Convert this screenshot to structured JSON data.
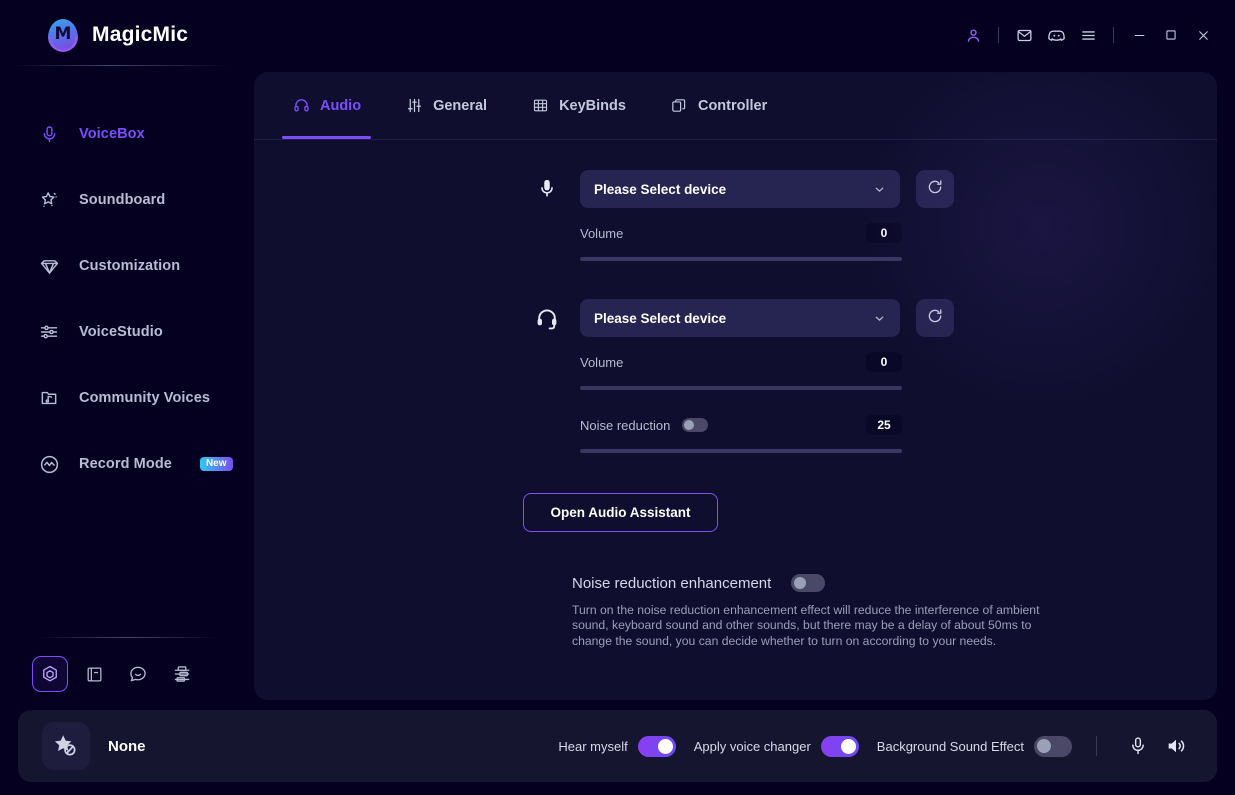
{
  "app": {
    "title": "MagicMic",
    "logo_icon": "magicmic-logo-icon"
  },
  "titlebar": {
    "actions": [
      {
        "name": "account-icon",
        "glyph": "person"
      },
      {
        "name": "mail-icon",
        "glyph": "mail"
      },
      {
        "name": "discord-icon",
        "glyph": "discord"
      },
      {
        "name": "menu-icon",
        "glyph": "hamburger"
      }
    ],
    "window_controls": [
      {
        "name": "minimize-button",
        "glyph": "minimize"
      },
      {
        "name": "maximize-button",
        "glyph": "maximize"
      },
      {
        "name": "close-button",
        "glyph": "close"
      }
    ]
  },
  "sidebar": {
    "items": [
      {
        "label": "VoiceBox",
        "icon": "microphone-icon",
        "active": true
      },
      {
        "label": "Soundboard",
        "icon": "magic-wand-icon",
        "active": false
      },
      {
        "label": "Customization",
        "icon": "diamond-icon",
        "active": false
      },
      {
        "label": "VoiceStudio",
        "icon": "sliders-icon",
        "active": false
      },
      {
        "label": "Community Voices",
        "icon": "music-folder-icon",
        "active": false
      },
      {
        "label": "Record Mode",
        "icon": "waveform-circle-icon",
        "active": false,
        "badge": "New"
      }
    ],
    "mini_icons": [
      {
        "name": "hexagon-target-icon",
        "active": true
      },
      {
        "name": "book-icon",
        "active": false
      },
      {
        "name": "chat-bubble-icon",
        "active": false
      },
      {
        "name": "flowchart-icon",
        "active": false
      }
    ]
  },
  "main": {
    "tabs": [
      {
        "label": "Audio",
        "icon": "headphones-icon",
        "active": true
      },
      {
        "label": "General",
        "icon": "sliders-icon",
        "active": false
      },
      {
        "label": "KeyBinds",
        "icon": "grid-icon",
        "active": false
      },
      {
        "label": "Controller",
        "icon": "copy-icon",
        "active": false
      }
    ],
    "input_device": {
      "icon": "microphone-icon",
      "select_value": "Please Select device",
      "select_placeholder": "Please Select device",
      "refresh_icon": "refresh-icon",
      "volume_label": "Volume",
      "volume_value": "0"
    },
    "output_device": {
      "icon": "headset-icon",
      "select_value": "Please Select device",
      "select_placeholder": "Please Select device",
      "refresh_icon": "refresh-icon",
      "volume_label": "Volume",
      "volume_value": "0",
      "noise_reduction_label": "Noise reduction",
      "noise_reduction_value": "25",
      "noise_reduction_enabled": false
    },
    "audio_assistant_button": "Open Audio Assistant",
    "noise_enhancement": {
      "title": "Noise reduction enhancement",
      "enabled": false,
      "description": "Turn on the noise reduction enhancement effect will reduce the interference of ambient sound, keyboard sound and other sounds, but there may be a delay of about 50ms to change the sound, you can decide whether to turn on according to your needs."
    }
  },
  "footer": {
    "voice_thumb_icon": "star-none-icon",
    "voice_name": "None",
    "controls": [
      {
        "label": "Hear myself",
        "on": true
      },
      {
        "label": "Apply voice changer",
        "on": true
      },
      {
        "label": "Background Sound Effect",
        "on": false
      }
    ],
    "mic_icon": "microphone-icon",
    "speaker_icon": "speaker-icon"
  },
  "colors": {
    "accent": "#7c4dff",
    "accent_alt": "#8b3ff0",
    "background": "#05001f",
    "panel": "#0f0e2e",
    "footer": "#161530",
    "badge_gradient_start": "#2ec8f5",
    "badge_gradient_end": "#7b4df0"
  }
}
